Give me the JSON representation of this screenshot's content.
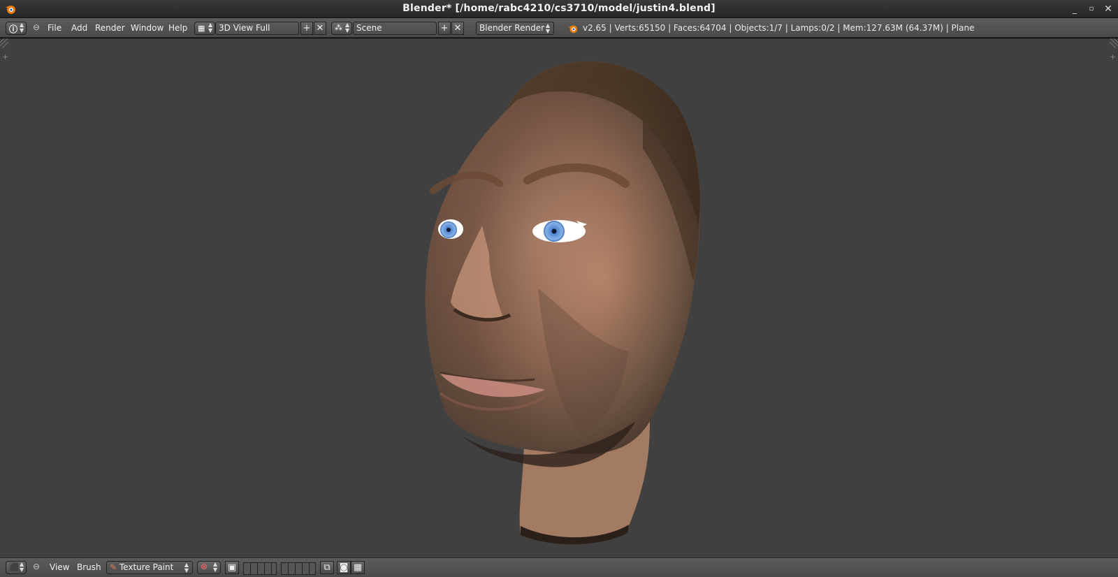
{
  "window": {
    "title": "Blender* [/home/rabc4210/cs3710/model/justin4.blend]"
  },
  "info_header": {
    "editor_type_icon": "info-icon",
    "menus": [
      "File",
      "Add",
      "Render",
      "Window",
      "Help"
    ],
    "screen_layout": "3D View Full",
    "scene": "Scene",
    "render_engine": "Blender Render",
    "stats": "v2.65 | Verts:65150 | Faces:64704 | Objects:1/7 | Lamps:0/2 | Mem:127.63M (64.37M) | Plane"
  },
  "bottom_header": {
    "editor_type_icon": "3d-view-icon",
    "menus": [
      "View",
      "Brush"
    ],
    "mode": "Texture Paint"
  },
  "colors": {
    "viewport_bg": "#404040",
    "header_bg": "#4f4f4f",
    "eye_iris": "#5b8fd6"
  }
}
